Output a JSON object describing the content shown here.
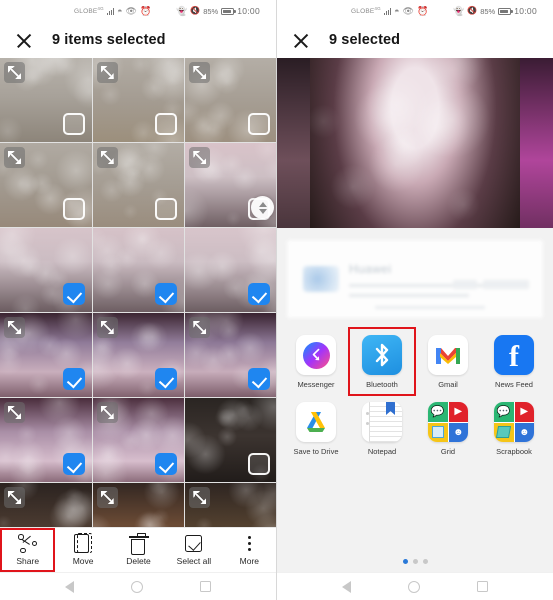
{
  "left_panel": {
    "statusbar": {
      "carrier": "GLOBE",
      "network": "4G",
      "icons": [
        "signal-bars-icon",
        "wifi-icon",
        "eye-care-icon",
        "alarm-icon",
        "bluetooth-icon",
        "mute-icon"
      ],
      "battery_percent": "85%",
      "clock": "10:00"
    },
    "appbar": {
      "close_label": "close",
      "title": "9 items selected"
    },
    "grid": {
      "columns": 3,
      "cells": [
        {
          "selected": false,
          "expand": true,
          "theme": "portrait-wall"
        },
        {
          "selected": false,
          "expand": true,
          "theme": "duo-wall"
        },
        {
          "selected": false,
          "expand": true,
          "theme": "duo-wall-2"
        },
        {
          "selected": false,
          "expand": true,
          "theme": "duo-wall-3"
        },
        {
          "selected": false,
          "expand": true,
          "theme": "duo-wall-4"
        },
        {
          "selected": false,
          "expand": true,
          "theme": "stage-group"
        },
        {
          "selected": true,
          "expand": false,
          "theme": "stage-group-2"
        },
        {
          "selected": true,
          "expand": false,
          "theme": "stage-group-3"
        },
        {
          "selected": true,
          "expand": false,
          "theme": "stage-group-4"
        },
        {
          "selected": true,
          "expand": true,
          "theme": "stage-lights"
        },
        {
          "selected": true,
          "expand": true,
          "theme": "stage-lights-2"
        },
        {
          "selected": true,
          "expand": true,
          "theme": "stage-lights-3"
        },
        {
          "selected": true,
          "expand": true,
          "theme": "stage-crowd"
        },
        {
          "selected": true,
          "expand": true,
          "theme": "stage-crowd-2"
        },
        {
          "selected": false,
          "expand": false,
          "theme": "dark-indoor"
        },
        {
          "selected": false,
          "expand": true,
          "theme": "night-blur"
        },
        {
          "selected": false,
          "expand": true,
          "theme": "night-blur-2"
        },
        {
          "selected": false,
          "expand": true,
          "theme": "night-blur-3"
        }
      ]
    },
    "actionbar": {
      "highlighted": "Share",
      "items": [
        {
          "label": "Share",
          "icon": "share-icon"
        },
        {
          "label": "Move",
          "icon": "move-icon"
        },
        {
          "label": "Delete",
          "icon": "trash-icon"
        },
        {
          "label": "Select all",
          "icon": "select-all-icon"
        },
        {
          "label": "More",
          "icon": "more-vertical-icon"
        }
      ]
    }
  },
  "right_panel": {
    "statusbar": {
      "carrier": "GLOBE",
      "network": "4G",
      "battery_percent": "85%",
      "clock": "10:00"
    },
    "appbar": {
      "close_label": "close",
      "title": "9 selected"
    },
    "preview_card": {
      "brand": "Huawei"
    },
    "share_sheet": {
      "rows": [
        [
          {
            "label": "Messenger",
            "icon": "messenger-icon",
            "highlighted": false
          },
          {
            "label": "Bluetooth",
            "icon": "bluetooth-icon",
            "highlighted": true
          },
          {
            "label": "Gmail",
            "icon": "gmail-icon",
            "highlighted": false
          },
          {
            "label": "News Feed",
            "icon": "facebook-icon",
            "highlighted": false
          }
        ],
        [
          {
            "label": "Save to Drive",
            "icon": "google-drive-icon",
            "highlighted": false
          },
          {
            "label": "Notepad",
            "icon": "notepad-icon",
            "highlighted": false
          },
          {
            "label": "Grid",
            "icon": "grid-app-icon",
            "highlighted": false
          },
          {
            "label": "Scrapbook",
            "icon": "scrapbook-icon",
            "highlighted": false
          }
        ]
      ],
      "pages": 3,
      "active_page": 1
    }
  },
  "navbar": {
    "items": [
      {
        "label": "Back",
        "icon": "back-triangle-icon"
      },
      {
        "label": "Home",
        "icon": "home-circle-icon"
      },
      {
        "label": "Recents",
        "icon": "recents-square-icon"
      }
    ]
  },
  "colors": {
    "accent_blue": "#1f86f0",
    "highlight_red": "#e0141b",
    "sheet_bg": "#f2f2f2"
  }
}
